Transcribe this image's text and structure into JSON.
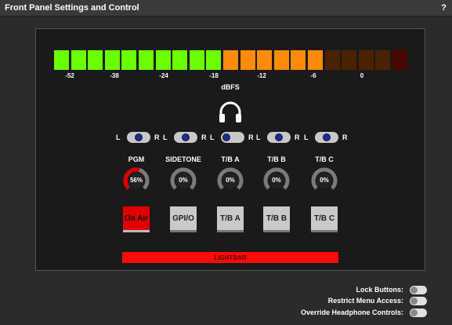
{
  "window": {
    "title": "Front Panel Settings and Control",
    "help": "?"
  },
  "meter": {
    "ticks": [
      "-52",
      "-38",
      "-24",
      "-18",
      "-12",
      "-6",
      "0"
    ],
    "unit": "dBFS",
    "lit_green": 10,
    "lit_orange": 6,
    "dim_segments": 5,
    "colors": {
      "green": "#6aff00",
      "orange": "#ff8a0a",
      "dim": "#4a2200",
      "dim_red": "#4a0800"
    }
  },
  "headphone_icon": "headphones-icon",
  "channels": [
    {
      "label": "PGM",
      "level": "56%",
      "level_value": 0.56,
      "balance": 0.5,
      "button": "On Air",
      "button_state": "active"
    },
    {
      "label": "SIDETONE",
      "level": "0%",
      "level_value": 0,
      "balance": 0.5,
      "button": "GPI/O",
      "button_state": "normal"
    },
    {
      "label": "T/B A",
      "level": "0%",
      "level_value": 0,
      "balance": 0.0,
      "button": "T/B A",
      "button_state": "normal"
    },
    {
      "label": "T/B B",
      "level": "0%",
      "level_value": 0,
      "balance": 0.5,
      "button": "T/B B",
      "button_state": "normal"
    },
    {
      "label": "T/B C",
      "level": "0%",
      "level_value": 0,
      "balance": 0.5,
      "button": "T/B C",
      "button_state": "normal"
    }
  ],
  "balance_labels": {
    "left": "L",
    "right": "R"
  },
  "lightbar": {
    "label": "LIGHTBAR",
    "color": "#ff0a0a"
  },
  "settings": [
    {
      "label": "Lock Buttons:",
      "on": false
    },
    {
      "label": "Restrict Menu Access:",
      "on": false
    },
    {
      "label": "Override Headphone Controls:",
      "on": false
    }
  ]
}
